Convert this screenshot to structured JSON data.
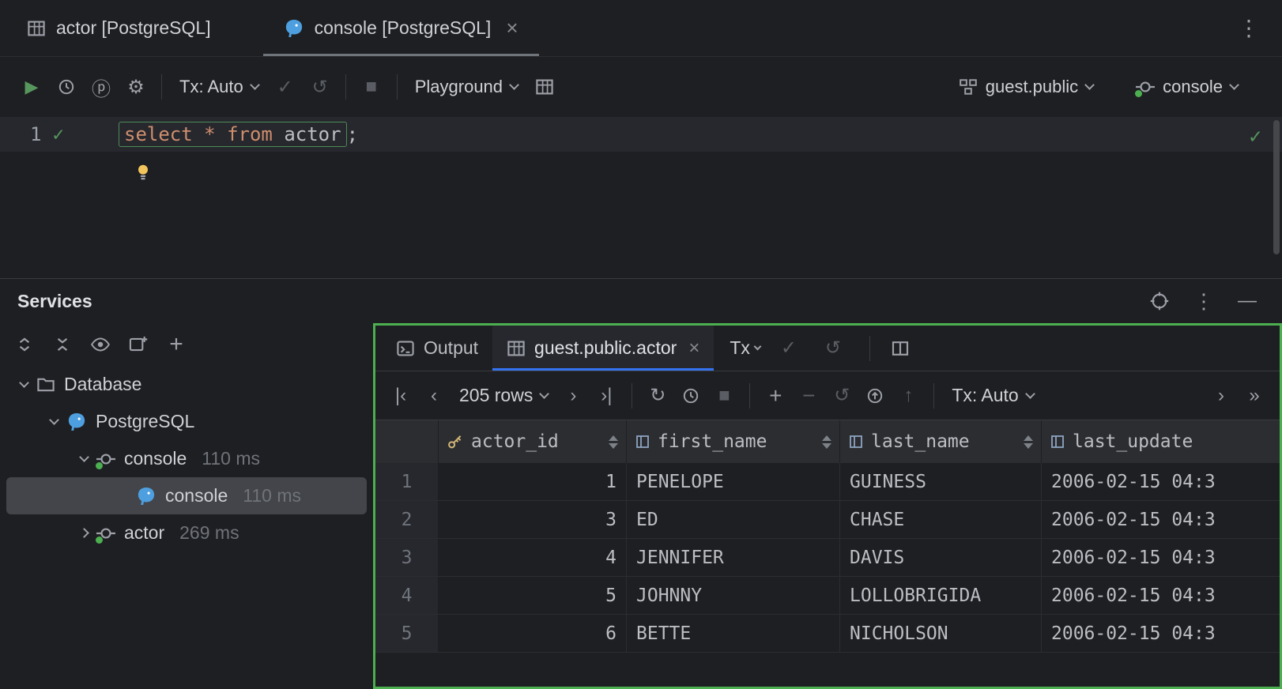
{
  "window": {
    "tabs": [
      {
        "label": "actor [PostgreSQL]"
      },
      {
        "label": "console [PostgreSQL]"
      }
    ]
  },
  "icons": {
    "run": "▶",
    "gear": "⚙",
    "profiler": "ⓟ",
    "check": "✓",
    "rollback": "↺",
    "refresh": "↻",
    "stop": "■",
    "kebab": "⋮",
    "close": "×",
    "minimize": "—",
    "plus": "+",
    "minus": "−",
    "up": "↑",
    "first_page": "|‹",
    "prev_page": "‹",
    "next_page": "›",
    "last_page": "›|",
    "chevron": "›",
    "chevron_double": "»"
  },
  "toolbar": {
    "tx_auto": "Tx: Auto",
    "playground": "Playground",
    "schema": "guest.public",
    "session": "console"
  },
  "editor": {
    "line_number": "1",
    "kw_select": "select",
    "star": "*",
    "kw_from": "from",
    "table_ref": "actor",
    "semicolon": ";"
  },
  "services": {
    "title": "Services",
    "tree": [
      {
        "label": "Database"
      },
      {
        "label": "PostgreSQL"
      },
      {
        "label": "console",
        "time": "110 ms"
      },
      {
        "label": "console",
        "time": "110 ms"
      },
      {
        "label": "actor",
        "time": "269 ms"
      }
    ]
  },
  "results": {
    "output_tab": "Output",
    "table_tab": "guest.public.actor",
    "tx_short": "Tx",
    "rows_count": "205 rows",
    "tx_auto": "Tx: Auto",
    "grid": {
      "columns": [
        "actor_id",
        "first_name",
        "last_name",
        "last_update"
      ],
      "rows": [
        {
          "n": "1",
          "id": "1",
          "first": "PENELOPE",
          "last": "GUINESS",
          "updated": "2006-02-15 04:3"
        },
        {
          "n": "2",
          "id": "3",
          "first": "ED",
          "last": "CHASE",
          "updated": "2006-02-15 04:3"
        },
        {
          "n": "3",
          "id": "4",
          "first": "JENNIFER",
          "last": "DAVIS",
          "updated": "2006-02-15 04:3"
        },
        {
          "n": "4",
          "id": "5",
          "first": "JOHNNY",
          "last": "LOLLOBRIGIDA",
          "updated": "2006-02-15 04:3"
        },
        {
          "n": "5",
          "id": "6",
          "first": "BETTE",
          "last": "NICHOLSON",
          "updated": "2006-02-15 04:3"
        }
      ]
    }
  },
  "colors": {
    "accent_green": "#4caf50",
    "accent_blue": "#3574f0",
    "keyword_orange": "#cf8e6d",
    "check_green": "#57965c",
    "key_gold": "#d5b778"
  }
}
